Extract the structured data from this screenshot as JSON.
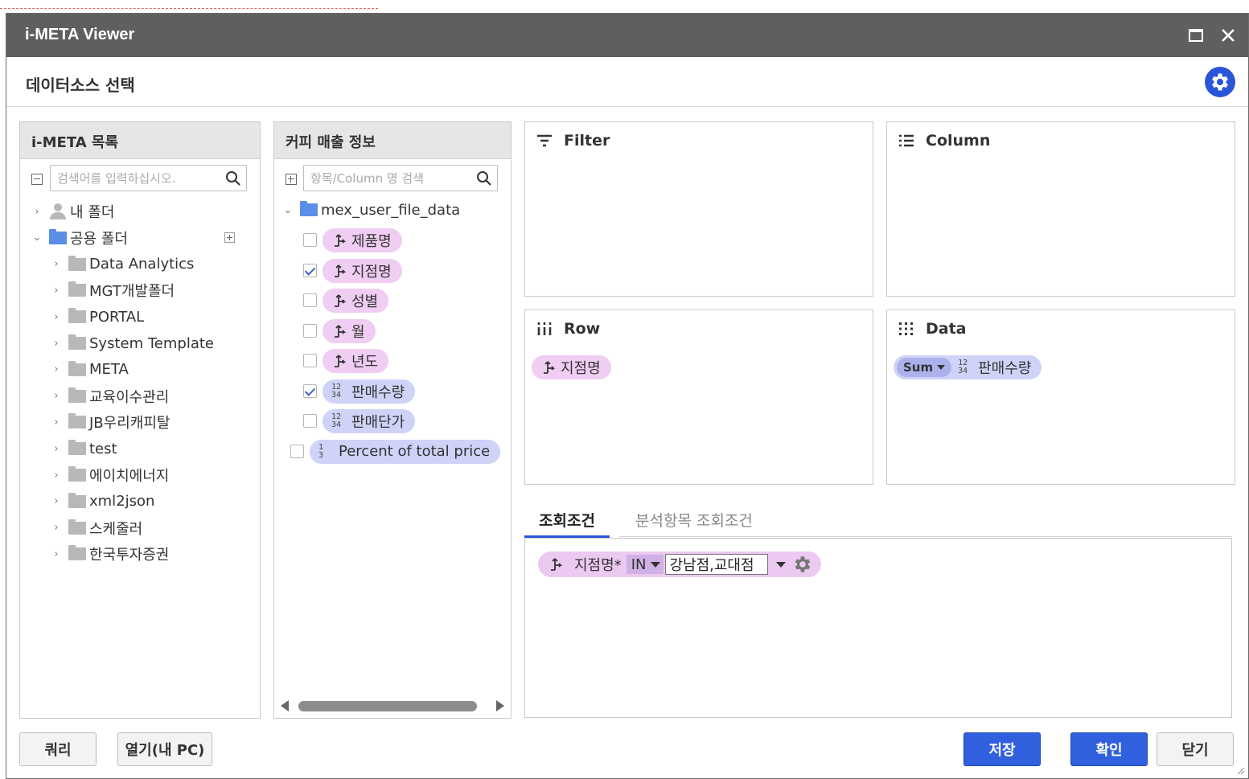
{
  "window": {
    "title": "i-META Viewer"
  },
  "header": {
    "title": "데이터소스 선택"
  },
  "catalog": {
    "title": "i-META 목록",
    "search_placeholder": "검색어를 입력하십시오.",
    "tree": [
      {
        "label": "내 폴더",
        "icon": "user-icon",
        "expanded": false,
        "level": 0
      },
      {
        "label": "공용 폴더",
        "icon": "folder-icon",
        "expanded": true,
        "level": 0
      },
      {
        "label": "Data Analytics",
        "level": 1
      },
      {
        "label": "MGT개발폴더",
        "level": 1
      },
      {
        "label": "PORTAL",
        "level": 1
      },
      {
        "label": "System Template",
        "level": 1
      },
      {
        "label": "META",
        "level": 1
      },
      {
        "label": "교육이수관리",
        "level": 1
      },
      {
        "label": "JB우리캐피탈",
        "level": 1
      },
      {
        "label": "test",
        "level": 1
      },
      {
        "label": "에이치에너지",
        "level": 1
      },
      {
        "label": "xml2json",
        "level": 1
      },
      {
        "label": "스케줄러",
        "level": 1
      },
      {
        "label": "한국투자증권",
        "level": 1
      }
    ]
  },
  "fields": {
    "title": "커피 매출 정보",
    "search_placeholder": "항목/Column 명 검색",
    "datasource": "mex_user_file_data",
    "items": [
      {
        "label": "제품명",
        "type": "dimension",
        "checked": false
      },
      {
        "label": "지점명",
        "type": "dimension",
        "checked": true
      },
      {
        "label": "성별",
        "type": "dimension",
        "checked": false
      },
      {
        "label": "월",
        "type": "dimension",
        "checked": false
      },
      {
        "label": "년도",
        "type": "dimension",
        "checked": false
      },
      {
        "label": "판매수량",
        "type": "measure",
        "checked": true
      },
      {
        "label": "판매단가",
        "type": "measure",
        "checked": false
      },
      {
        "label": "Percent of total price",
        "type": "calc",
        "checked": false
      }
    ]
  },
  "zones": {
    "filter": {
      "title": "Filter"
    },
    "column": {
      "title": "Column"
    },
    "row": {
      "title": "Row",
      "chip": "지점명"
    },
    "data": {
      "title": "Data",
      "agg": "Sum",
      "chip": "판매수량"
    }
  },
  "numeric_icon": {
    "top": "12",
    "bottom": "34"
  },
  "calc_icon": {
    "top": "1",
    "bottom": "3"
  },
  "conditions": {
    "tabs": [
      {
        "label": "조회조건",
        "active": true
      },
      {
        "label": "분석항목 조회조건",
        "active": false
      }
    ],
    "items": [
      {
        "field": "지점명*",
        "operator": "IN",
        "value": "강남점,교대점"
      }
    ]
  },
  "buttons": {
    "query": "쿼리",
    "open_pc": "열기(내 PC)",
    "save": "저장",
    "confirm": "확인",
    "close": "닫기"
  },
  "colors": {
    "titlebar": "#5f5f5f",
    "accent": "#3060de",
    "dim_pill": "#f0cdf3",
    "measure_pill": "#cfd3f7"
  }
}
